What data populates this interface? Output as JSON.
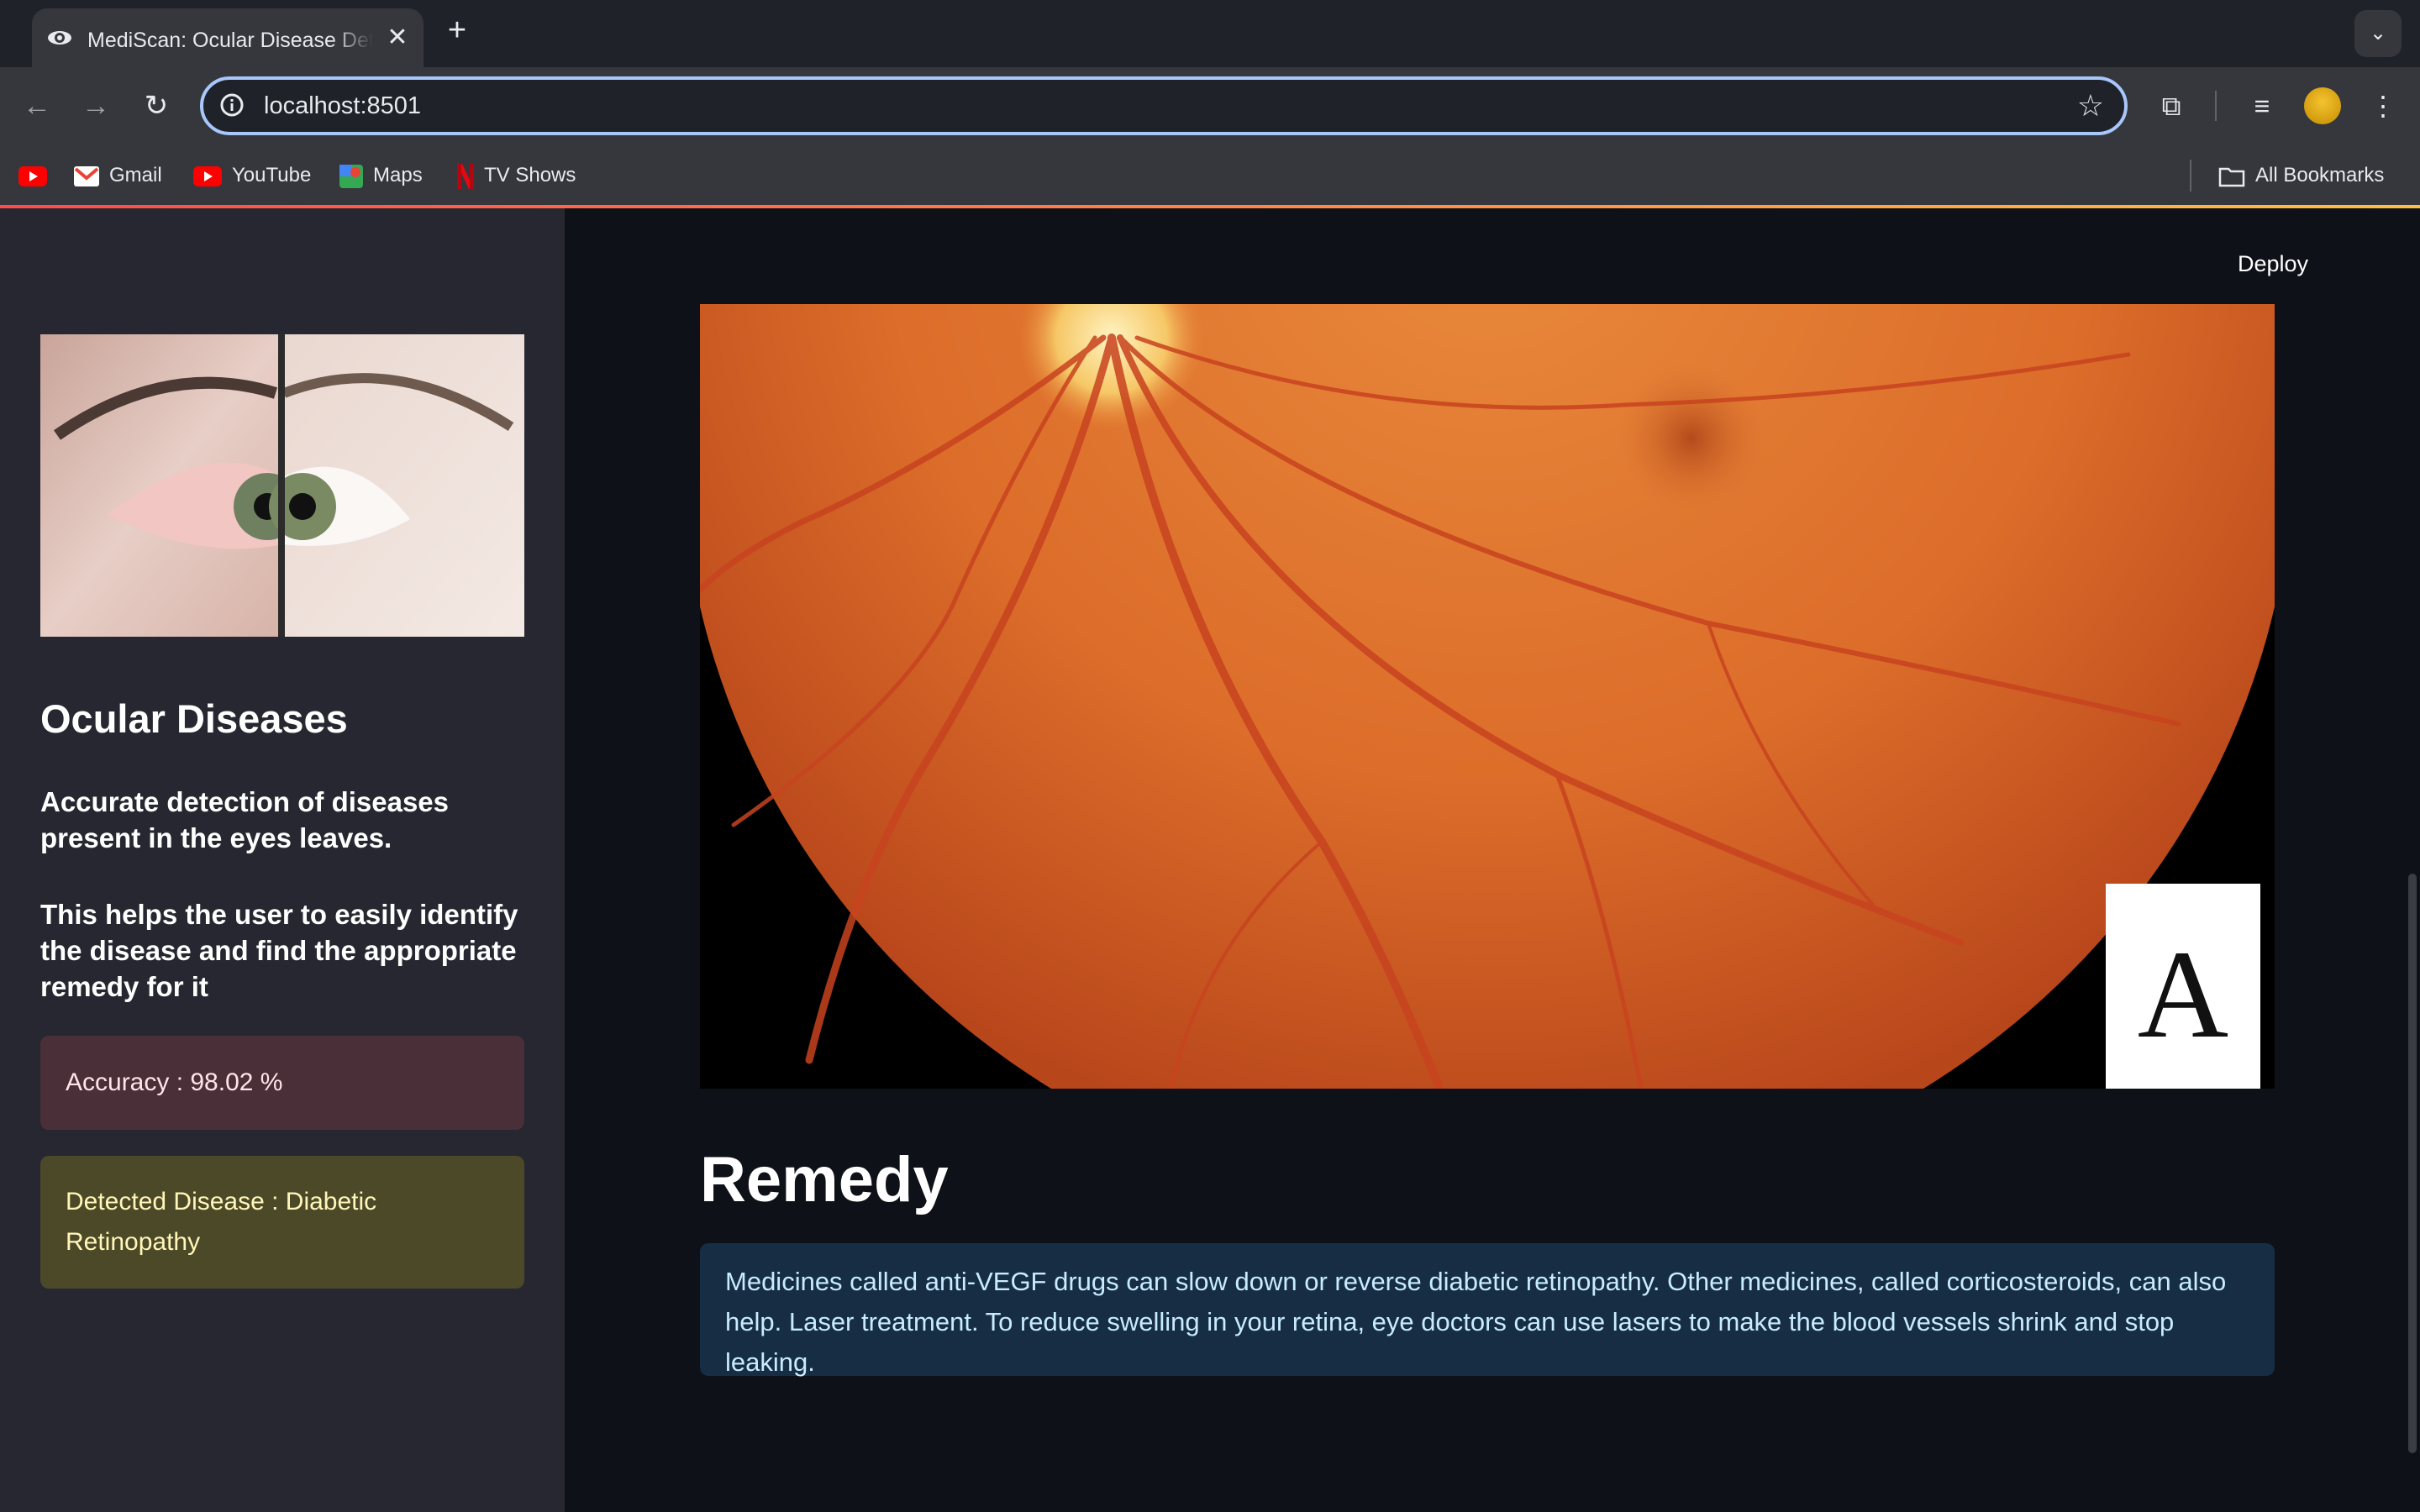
{
  "browser": {
    "tab_title": "MediScan: Ocular Disease Detection",
    "tab_close": "✕",
    "new_tab": "+",
    "url": "localhost:8501",
    "bookmarks": [
      {
        "label": "",
        "icon": "youtube-icon"
      },
      {
        "label": "Gmail",
        "icon": "gmail-icon"
      },
      {
        "label": "YouTube",
        "icon": "youtube-icon"
      },
      {
        "label": "Maps",
        "icon": "maps-icon"
      },
      {
        "label": "TV Shows",
        "icon": "netflix-icon"
      }
    ],
    "all_bookmarks": "All Bookmarks"
  },
  "app": {
    "deploy_label": "Deploy",
    "sidebar": {
      "title": "Ocular Diseases",
      "description": "Accurate detection of diseases present in the eyes leaves.",
      "help_text": "This helps the user to easily identify the disease and find the appropriate remedy for it",
      "accuracy": "Accuracy : 98.02 %",
      "detected": "Detected Disease : Diabetic Retinopathy"
    },
    "main": {
      "image_label_letter": "A",
      "remedy_heading": "Remedy",
      "remedy_text": "Medicines called anti-VEGF drugs can slow down or reverse diabetic retinopathy. Other medicines, called corticosteroids, can also help. Laser treatment. To reduce swelling in your retina, eye doctors can use lasers to make the blood vessels shrink and stop leaking."
    }
  },
  "colors": {
    "accent": "#ff4b4b",
    "sidebar_bg": "#262730",
    "main_bg": "#0e1117",
    "info_bg": "#172d43",
    "error_bg": "#4a2f38",
    "warning_bg": "#4c4929"
  }
}
